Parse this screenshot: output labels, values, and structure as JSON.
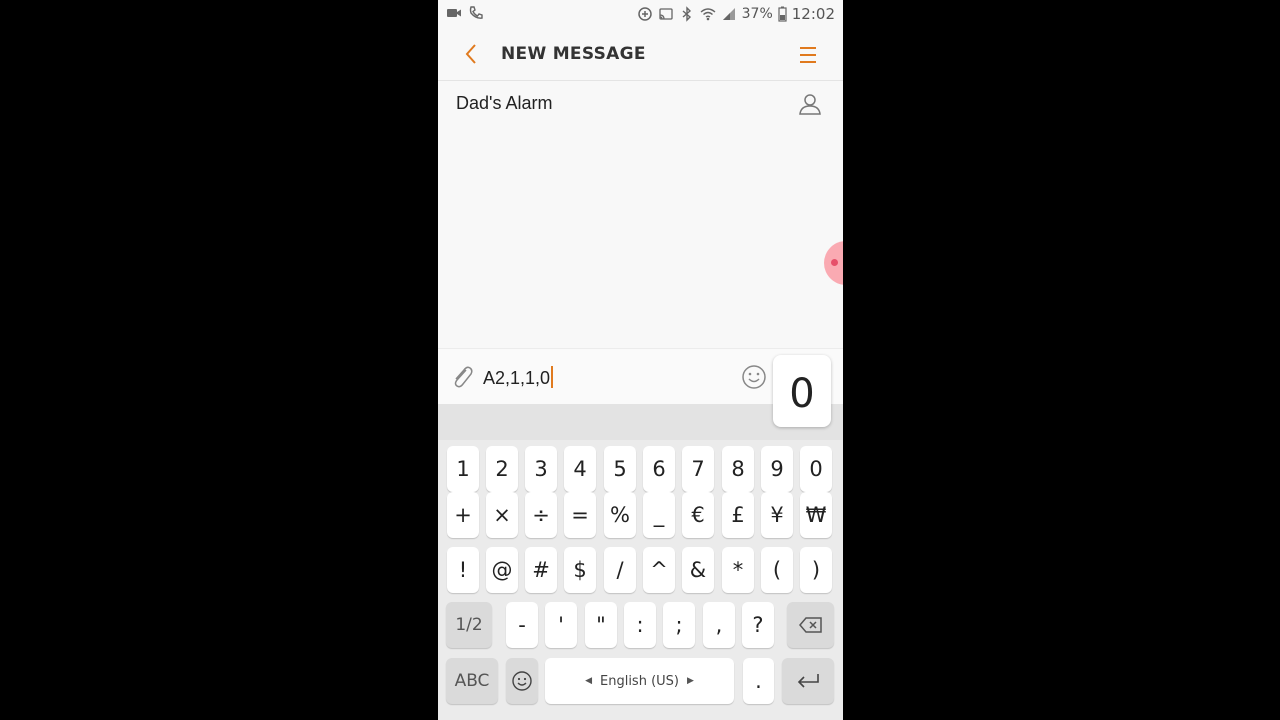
{
  "status_bar": {
    "battery": "37%",
    "time": "12:02"
  },
  "app_bar": {
    "title": "NEW MESSAGE",
    "accent_color": "#e07a1e"
  },
  "recipient": {
    "name": "Dad's Alarm"
  },
  "composer": {
    "text": "A2,1,1,0",
    "key_preview": "0"
  },
  "keyboard": {
    "row1": [
      "1",
      "2",
      "3",
      "4",
      "5",
      "6",
      "7",
      "8",
      "9",
      "0"
    ],
    "row2": [
      "+",
      "×",
      "÷",
      "=",
      "%",
      "_",
      "€",
      "£",
      "¥",
      "₩"
    ],
    "row3": [
      "!",
      "@",
      "#",
      "$",
      "/",
      "^",
      "&",
      "*",
      "(",
      ")"
    ],
    "row4_page": "1/2",
    "row4": [
      "-",
      "'",
      "\"",
      ":",
      ";",
      ",",
      "?"
    ],
    "abc": "ABC",
    "space_label": "English (US)",
    "period": "."
  }
}
